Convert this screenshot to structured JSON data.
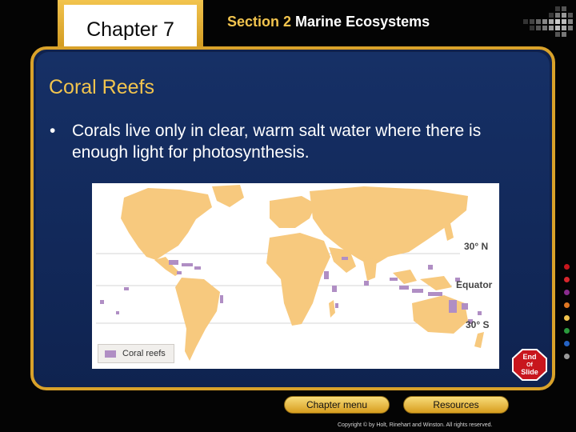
{
  "header": {
    "chapter_label": "Chapter 7",
    "section_number": "Section 2",
    "section_title": "Marine Ecosystems"
  },
  "slide": {
    "title": "Coral Reefs",
    "bullet_mark": "•",
    "bullet_text": "Corals live only in clear, warm salt water where there is enough light for photosynthesis."
  },
  "map": {
    "legend_label": "Coral reefs",
    "lat_north": "30° N",
    "equator": "Equator",
    "lat_south": "30° S",
    "land_color": "#f7c97e",
    "reef_color": "#b08ec4"
  },
  "nav": {
    "end_line1": "End",
    "end_line2": "Of",
    "end_line3": "Slide",
    "chapter_menu": "Chapter menu",
    "resources": "Resources"
  },
  "footer": {
    "copyright": "Copyright © by Holt, Rinehart and Winston. All rights reserved."
  },
  "colors": {
    "accent_gold": "#f2c44e",
    "panel_blue": "#163066",
    "end_red": "#c8161d"
  }
}
